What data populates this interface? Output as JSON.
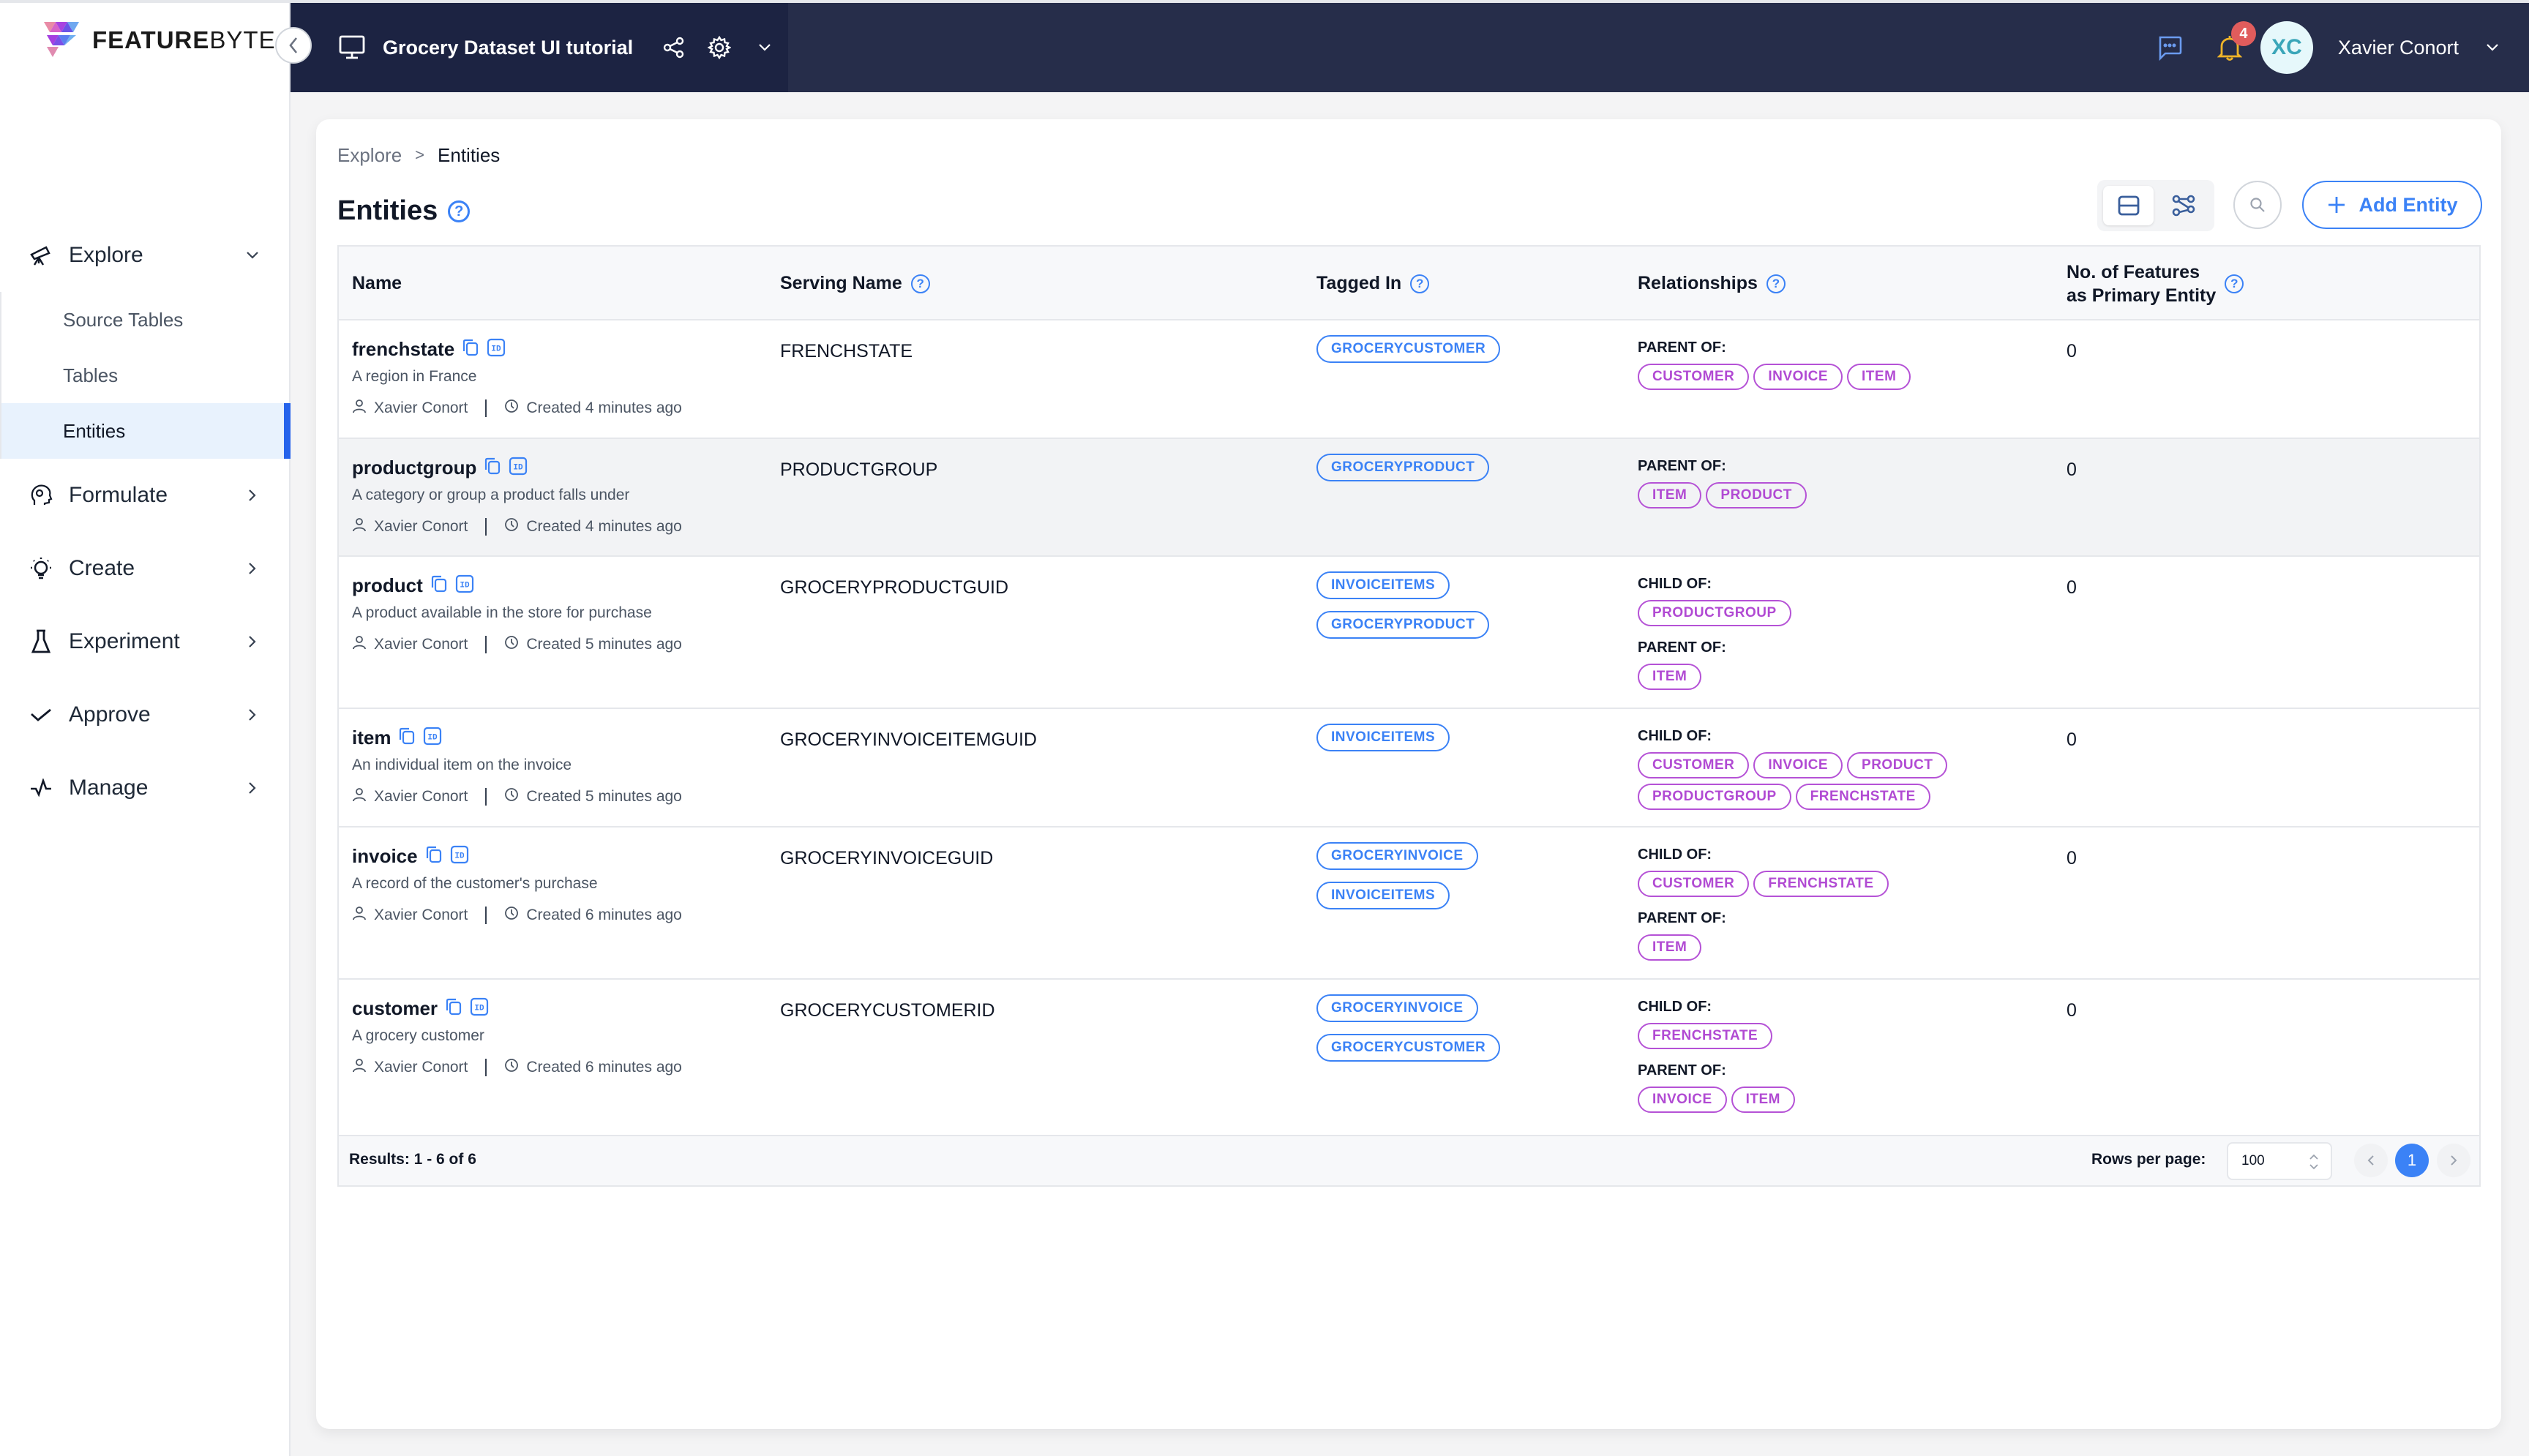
{
  "brand": {
    "name_bold": "FEATURE",
    "name_light": "BYTE"
  },
  "topbar": {
    "project_title": "Grocery Dataset UI tutorial",
    "notification_count": "4",
    "user_initials": "XC",
    "user_name": "Xavier Conort"
  },
  "sidebar": {
    "items": [
      {
        "label": "Explore",
        "icon": "telescope-icon",
        "expanded": true,
        "children": [
          {
            "label": "Source Tables",
            "active": false
          },
          {
            "label": "Tables",
            "active": false
          },
          {
            "label": "Entities",
            "active": true
          }
        ]
      },
      {
        "label": "Formulate",
        "icon": "head-gear-icon"
      },
      {
        "label": "Create",
        "icon": "lightbulb-icon"
      },
      {
        "label": "Experiment",
        "icon": "flask-icon"
      },
      {
        "label": "Approve",
        "icon": "check-icon"
      },
      {
        "label": "Manage",
        "icon": "pulse-icon"
      }
    ]
  },
  "breadcrumb": {
    "parent": "Explore",
    "separator": ">",
    "current": "Entities"
  },
  "page": {
    "title": "Entities",
    "add_button": "Add Entity"
  },
  "table": {
    "columns": {
      "name": "Name",
      "serving_name": "Serving Name",
      "tagged_in": "Tagged In",
      "relationships": "Relationships",
      "features_line1": "No. of Features",
      "features_line2": "as Primary Entity"
    },
    "rows": [
      {
        "name": "frenchstate",
        "description": "A region in France",
        "owner": "Xavier Conort",
        "created": "Created 4 minutes ago",
        "serving_name": "FRENCHSTATE",
        "tagged_in": [
          "GROCERYCUSTOMER"
        ],
        "relationships": [
          {
            "label": "PARENT OF:",
            "items": [
              "CUSTOMER",
              "INVOICE",
              "ITEM"
            ]
          }
        ],
        "features": "0"
      },
      {
        "name": "productgroup",
        "description": "A category or group a product falls under",
        "owner": "Xavier Conort",
        "created": "Created 4 minutes ago",
        "serving_name": "PRODUCTGROUP",
        "tagged_in": [
          "GROCERYPRODUCT"
        ],
        "relationships": [
          {
            "label": "PARENT OF:",
            "items": [
              "ITEM",
              "PRODUCT"
            ]
          }
        ],
        "features": "0"
      },
      {
        "name": "product",
        "description": "A product available in the store for purchase",
        "owner": "Xavier Conort",
        "created": "Created 5 minutes ago",
        "serving_name": "GROCERYPRODUCTGUID",
        "tagged_in": [
          "INVOICEITEMS",
          "GROCERYPRODUCT"
        ],
        "relationships": [
          {
            "label": "CHILD OF:",
            "items": [
              "PRODUCTGROUP"
            ]
          },
          {
            "label": "PARENT OF:",
            "items": [
              "ITEM"
            ]
          }
        ],
        "features": "0"
      },
      {
        "name": "item",
        "description": "An individual item on the invoice",
        "owner": "Xavier Conort",
        "created": "Created 5 minutes ago",
        "serving_name": "GROCERYINVOICEITEMGUID",
        "tagged_in": [
          "INVOICEITEMS"
        ],
        "relationships": [
          {
            "label": "CHILD OF:",
            "items": [
              "CUSTOMER",
              "INVOICE",
              "PRODUCT",
              "PRODUCTGROUP",
              "FRENCHSTATE"
            ]
          }
        ],
        "features": "0"
      },
      {
        "name": "invoice",
        "description": "A record of the customer's purchase",
        "owner": "Xavier Conort",
        "created": "Created 6 minutes ago",
        "serving_name": "GROCERYINVOICEGUID",
        "tagged_in": [
          "GROCERYINVOICE",
          "INVOICEITEMS"
        ],
        "relationships": [
          {
            "label": "CHILD OF:",
            "items": [
              "CUSTOMER",
              "FRENCHSTATE"
            ]
          },
          {
            "label": "PARENT OF:",
            "items": [
              "ITEM"
            ]
          }
        ],
        "features": "0"
      },
      {
        "name": "customer",
        "description": "A grocery customer",
        "owner": "Xavier Conort",
        "created": "Created 6 minutes ago",
        "serving_name": "GROCERYCUSTOMERID",
        "tagged_in": [
          "GROCERYINVOICE",
          "GROCERYCUSTOMER"
        ],
        "relationships": [
          {
            "label": "CHILD OF:",
            "items": [
              "FRENCHSTATE"
            ]
          },
          {
            "label": "PARENT OF:",
            "items": [
              "INVOICE",
              "ITEM"
            ]
          }
        ],
        "features": "0"
      }
    ],
    "footer": {
      "results": "Results: 1 - 6 of 6",
      "rows_per_page_label": "Rows per page:",
      "rows_per_page_value": "100",
      "current_page": "1"
    }
  },
  "colors": {
    "topbar": "#262d4a",
    "project_panel": "#1c2342",
    "accent": "#3b82f6",
    "chip_purple": "#b14ad3",
    "active_nav_bg": "#e8f2fd",
    "badge": "#e05c5c"
  }
}
